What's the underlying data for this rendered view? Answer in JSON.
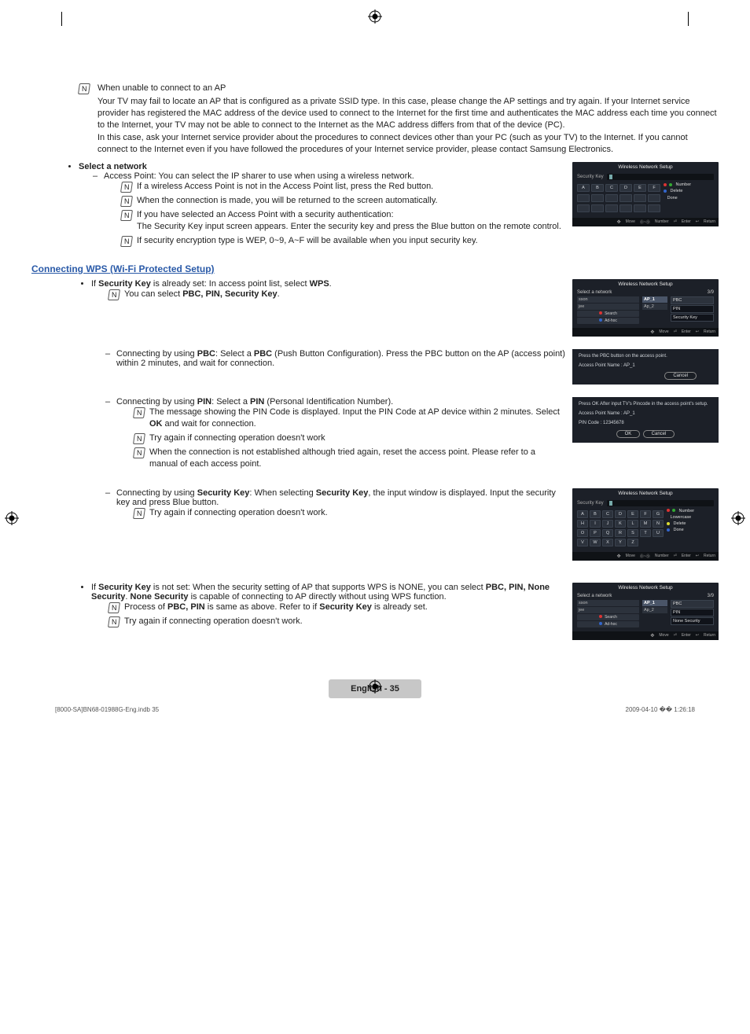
{
  "intro": {
    "heading": "When unable to connect to an AP",
    "p1": "Your TV may fail to locate an AP that is configured as a private SSID type. In this case, please change the AP settings and try again. If your Internet service provider has registered the MAC address of the device used to connect to the Internet for the first time and authenticates the MAC address each time you connect to the Internet, your TV may not be able to connect to the Internet as the MAC address differs from that of the device (PC).",
    "p2": "In this case, ask your Internet service provider about the procedures to connect devices other than your PC (such as your TV) to the Internet. If you cannot connect to the Internet even if you have followed the procedures of your Internet service provider, please contact Samsung Electronics."
  },
  "select_network": {
    "title": "Select a network",
    "ap_line": "Access Point: You can select the IP sharer to use when using a wireless network.",
    "n1": "If a wireless Access Point is not in the Access Point list, press the Red button.",
    "n2": "When the connection is made, you will be returned to the screen automatically.",
    "n3": "If you have selected an Access Point with a security authentication:",
    "n3b": "The Security Key input screen appears. Enter the security key and press the Blue button on the remote control.",
    "n4": "If security encryption type is WEP, 0~9, A~F will be available when you input security key."
  },
  "wps": {
    "section_title": "Connecting WPS (Wi-Fi Protected Setup)",
    "set_prefix": "If ",
    "set_mid": " is already set: In access point list, select ",
    "set_wps": "WPS",
    "note_select": "You can select ",
    "opts": "PBC, PIN, Security Key",
    "pbc_prefix": "Connecting by using ",
    "pbc": "PBC",
    "pbc_mid": ": Select a ",
    "pbc_desc": " (Push Button Configuration). Press the PBC button on the AP (access point) within 2 minutes, and wait for connection.",
    "pin_prefix": "Connecting by using ",
    "pin": "PIN",
    "pin_mid": ": Select a ",
    "pin_desc": " (Personal Identification Number).",
    "pin_n1a": "The message showing the PIN Code is displayed. Input the PIN Code at AP device within 2 minutes. Select ",
    "pin_n1b": "OK",
    "pin_n1c": " and wait for connection.",
    "pin_n2": "Try again if connecting operation doesn't work",
    "pin_n3": "When the connection is not established although tried again, reset the access point. Please refer to a manual of each access point.",
    "sk_prefix": "Connecting by using ",
    "sk": "Security Key",
    "sk_mid": ": When selecting ",
    "sk_desc": ", the input window is displayed. Input the security key and press Blue button.",
    "sk_n1": "Try again if connecting operation doesn't work.",
    "notset_a": "If ",
    "notset_b": "Security Key",
    "notset_c": " is not set: When the security setting of AP that supports WPS is NONE, you can select ",
    "notset_d": "PBC, PIN, None Security",
    "notset_e": ". ",
    "notset_f": "None Security",
    "notset_g": " is capable of connecting to AP directly without using WPS function.",
    "ns_n1a": "Process of ",
    "ns_n1b": "PBC, PIN",
    "ns_n1c": " is same as above. Refer to if ",
    "ns_n1d": "Security Key",
    "ns_n1e": " is already set.",
    "ns_n2": "Try again if connecting operation doesn't work."
  },
  "shots": {
    "title": "Wireless Network Setup",
    "seckey": "Security Key",
    "number": "Number",
    "lowercase": "Lowercase",
    "delete": "Delete",
    "done": "Done",
    "move": "Move",
    "numrange": "0~9 Number",
    "enter": "Enter",
    "return": "Return",
    "selectnet": "Select a network",
    "count": "3/9",
    "search": "Search",
    "adhoc": "Ad-hoc",
    "ap0": "sson",
    "ap1": "jee",
    "ap2": "AP_1",
    "ap3": "Ap_2",
    "pbc": "PBC",
    "pin": "PIN",
    "seckeyopt": "Security Key",
    "nonesec": "None Security",
    "pbc_msg1": "Press the PBC button on the access point.",
    "pbc_msg2": "Access Point Name : AP_1",
    "cancel": "Cancel",
    "pin_msg1": "Press OK After input TV's Pincode in the access point's setup.",
    "pin_msg2": "Access Point Name : AP_1",
    "pin_msg3": "PIN Code : 12345678",
    "ok": "OK"
  },
  "keys_hex": [
    "A",
    "B",
    "C",
    "D",
    "E",
    "F"
  ],
  "keys_full": [
    "A",
    "B",
    "C",
    "D",
    "E",
    "F",
    "G",
    "H",
    "I",
    "J",
    "K",
    "L",
    "M",
    "N",
    "O",
    "P",
    "Q",
    "R",
    "S",
    "T",
    "U",
    "V",
    "W",
    "X",
    "Y",
    "Z"
  ],
  "footer": {
    "page": "English - 35",
    "doc": "[8000-SA]BN68-01988G-Eng.indb   35",
    "ts": "2009-04-10   �� 1:26:18"
  }
}
